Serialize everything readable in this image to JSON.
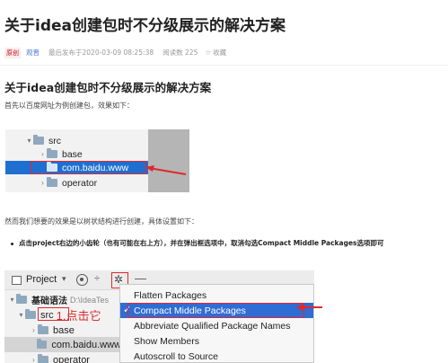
{
  "article": {
    "title": "关于idea创建包时不分级展示的解决方案",
    "meta": {
      "badge": "原创",
      "author": "观晋",
      "time": "最后发布于2020-03-09 08:25:38",
      "reads": "阅读数 225",
      "favorite_icon": "star-icon",
      "favorite_symbol": "☆",
      "favorite": "收藏"
    },
    "heading": "关于idea创建包时不分级展示的解决方案",
    "intro": "首先以百度网址为例创建包，效果如下：",
    "followup": "然而我们想要的效果是以树状结构进行创建，具体设置如下：",
    "bullet": "点击project右边的小齿轮（也有可能在右上方），并在弹出框选项中，取消勾选Compact Middle Packages选项即可"
  },
  "screenshot1": {
    "tree": [
      {
        "label": "src",
        "arrow": "▾",
        "selected": false
      },
      {
        "label": "base",
        "arrow": "›",
        "selected": false
      },
      {
        "label": "com.baidu.www",
        "arrow": "",
        "selected": true
      },
      {
        "label": "operator",
        "arrow": "›",
        "selected": false
      }
    ],
    "colors": {
      "selection": "#1f6fd1",
      "annotation": "#e0282d"
    }
  },
  "screenshot2": {
    "toolbar": {
      "project_label": "Project",
      "chevron": "▾",
      "collapse_symbol": "÷",
      "gear_symbol": "✲",
      "minus_symbol": "—"
    },
    "tree": [
      {
        "label": "基础语法",
        "path": "D:\\IdeaTes",
        "arrow": "▾"
      },
      {
        "label": "src",
        "arrow": "▾",
        "annotation": "1.点击它"
      },
      {
        "label": "base",
        "arrow": "›"
      },
      {
        "label": "com.baidu.www",
        "arrow": ""
      },
      {
        "label": "operator",
        "arrow": "›"
      }
    ],
    "menu": {
      "items": [
        {
          "label": "Flatten Packages",
          "checked": false
        },
        {
          "label": "Compact Middle Packages",
          "checked": true
        },
        {
          "label": "Abbreviate Qualified Package Names",
          "checked": false
        },
        {
          "label": "Show Members",
          "checked": false
        },
        {
          "label": "Autoscroll to Source",
          "checked": false
        }
      ],
      "check_symbol": "✓"
    }
  }
}
